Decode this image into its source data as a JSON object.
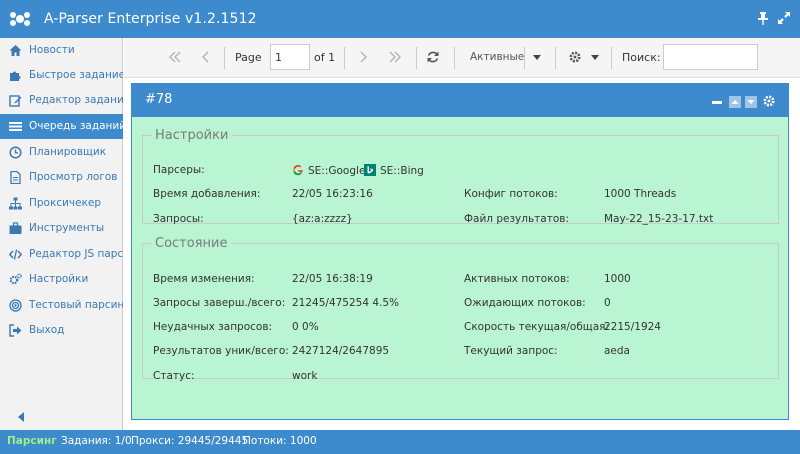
{
  "window": {
    "title": "A-Parser Enterprise v1.2.1512"
  },
  "sidebar": {
    "items": [
      {
        "label": "Новости",
        "icon": "home-icon"
      },
      {
        "label": "Быстрое задание",
        "icon": "puzzle-icon"
      },
      {
        "label": "Редактор заданий",
        "icon": "edit-icon"
      },
      {
        "label": "Очередь заданий",
        "icon": "list-icon",
        "active": true
      },
      {
        "label": "Планировщик",
        "icon": "clock-icon"
      },
      {
        "label": "Просмотр логов",
        "icon": "file-icon"
      },
      {
        "label": "Проксичекер",
        "icon": "sitemap-icon"
      },
      {
        "label": "Инструменты",
        "icon": "briefcase-icon"
      },
      {
        "label": "Редактор JS парс...",
        "icon": "code-icon"
      },
      {
        "label": "Настройки",
        "icon": "cogs-icon"
      },
      {
        "label": "Тестовый парсинг",
        "icon": "target-icon"
      },
      {
        "label": "Выход",
        "icon": "sign-out-icon"
      }
    ]
  },
  "toolbar": {
    "page_label": "Page",
    "page_value": "1",
    "of_label": "of 1",
    "filter_label": "Активные",
    "search_label": "Поиск:",
    "search_value": ""
  },
  "task": {
    "title": "#78",
    "settings": {
      "legend": "Настройки",
      "parsers_label": "Парсеры:",
      "parsers": [
        {
          "name": "SE::Google",
          "icon": "google-icon"
        },
        {
          "name": "SE::Bing",
          "icon": "bing-icon"
        }
      ],
      "added_label": "Время добавления:",
      "added_value": "22/05 16:23:16",
      "threads_config_label": "Конфиг потоков:",
      "threads_config_value": "1000 Threads",
      "queries_label": "Запросы:",
      "queries_value": "{az:a:zzzz}",
      "result_file_label": "Файл результатов:",
      "result_file_value": "May-22_15-23-17.txt"
    },
    "state": {
      "legend": "Состояние",
      "changed_label": "Время изменения:",
      "changed_value": "22/05 16:38:19",
      "active_threads_label": "Активных потоков:",
      "active_threads_value": "1000",
      "done_label": "Запросы заверш./всего:",
      "done_value": "21245/475254 4.5%",
      "waiting_label": "Ожидающих потоков:",
      "waiting_value": "0",
      "failed_label": "Неудачных запросов:",
      "failed_value": "0 0%",
      "speed_label": "Скорость текущая/общая:",
      "speed_value": "2215/1924",
      "results_label": "Результатов уник/всего:",
      "results_value": "2427124/2647895",
      "current_label": "Текущий запрос:",
      "current_value": "aeda",
      "status_label": "Статус:",
      "status_value": "work"
    }
  },
  "statusbar": {
    "parsing": "Парсинг",
    "tasks": "Задания: 1/0",
    "proxy": "Прокси: 29445/29445",
    "threads": "Потоки: 1000"
  },
  "colors": {
    "accent": "#3d8bcd",
    "panel_bg": "#b9f5d2",
    "parsing_green": "#9ff08a"
  }
}
